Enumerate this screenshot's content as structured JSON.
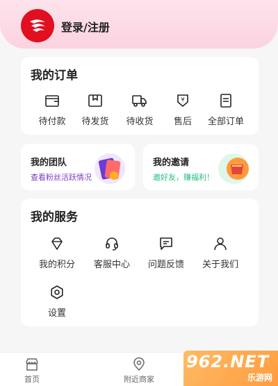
{
  "header": {
    "login_label": "登录/注册"
  },
  "orders": {
    "title": "我的订单",
    "items": [
      {
        "label": "待付款",
        "icon": "wallet-icon"
      },
      {
        "label": "待发货",
        "icon": "package-icon"
      },
      {
        "label": "待收货",
        "icon": "truck-icon"
      },
      {
        "label": "售后",
        "icon": "refund-icon"
      },
      {
        "label": "全部订单",
        "icon": "order-list-icon"
      }
    ]
  },
  "team": {
    "title": "我的团队",
    "subtitle": "查看粉丝活跃情况",
    "accent": "#7b3fc4"
  },
  "invite": {
    "title": "我的邀请",
    "subtitle": "邀好友，赚福利！",
    "accent": "#1fbf7a"
  },
  "services": {
    "title": "我的服务",
    "items": [
      {
        "label": "我的积分",
        "icon": "diamond-icon"
      },
      {
        "label": "客服中心",
        "icon": "headset-icon"
      },
      {
        "label": "问题反馈",
        "icon": "feedback-icon"
      },
      {
        "label": "关于我们",
        "icon": "user-icon"
      },
      {
        "label": "设置",
        "icon": "settings-icon"
      }
    ]
  },
  "tabbar": {
    "items": [
      {
        "label": "首页",
        "icon": "shop-icon"
      },
      {
        "label": "附近商家",
        "icon": "location-icon"
      }
    ]
  },
  "watermark": {
    "main": "962.NET",
    "sub": "乐游网"
  }
}
